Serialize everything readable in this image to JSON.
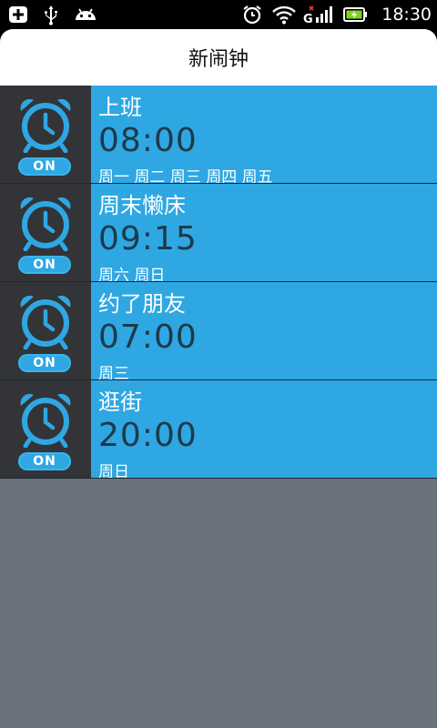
{
  "status_bar": {
    "left_icons": [
      "add-icon",
      "usb-icon",
      "android-icon"
    ],
    "right_icons": [
      "alarm-clock-icon",
      "wifi-icon",
      "signal-icon",
      "battery-charging-icon"
    ],
    "signal_label": "G",
    "time": "18:30"
  },
  "header": {
    "title": "新闹钟"
  },
  "alarms": [
    {
      "name": "上班",
      "time": "08:00",
      "days": "周一 周二 周三 周四 周五",
      "toggle": "ON"
    },
    {
      "name": "周末懒床",
      "time": "09:15",
      "days": "周六 周日",
      "toggle": "ON"
    },
    {
      "name": "约了朋友",
      "time": "07:00",
      "days": "周三",
      "toggle": "ON"
    },
    {
      "name": "逛街",
      "time": "20:00",
      "days": "周日",
      "toggle": "ON"
    }
  ],
  "colors": {
    "accent": "#2fa7e2",
    "icon_cell_bg": "#333437",
    "list_bg": "#6b717c",
    "time_text": "#1d3a4a"
  }
}
